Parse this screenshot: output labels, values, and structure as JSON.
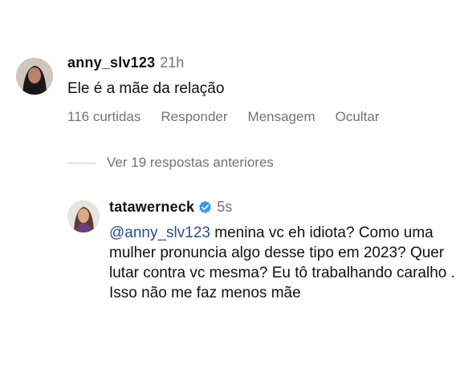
{
  "comment": {
    "username": "anny_slv123",
    "time": "21h",
    "text": "Ele é a mãe da relação",
    "actions": {
      "likes": "116 curtidas",
      "reply": "Responder",
      "message": "Mensagem",
      "hide": "Ocultar"
    }
  },
  "view_previous_replies": "Ver 19 respostas anteriores",
  "reply": {
    "username": "tatawerneck",
    "verified": true,
    "time": "5s",
    "mention": "@anny_slv123",
    "text": " menina vc eh idiota? Como uma mulher pronuncia algo desse tipo em 2023? Quer lutar contra vc mesma? Eu tô trabalhando caralho . Isso não me faz menos mãe"
  },
  "colors": {
    "secondary_text": "#737373",
    "mention": "#2a4e8e",
    "verified_badge": "#3797f0"
  }
}
